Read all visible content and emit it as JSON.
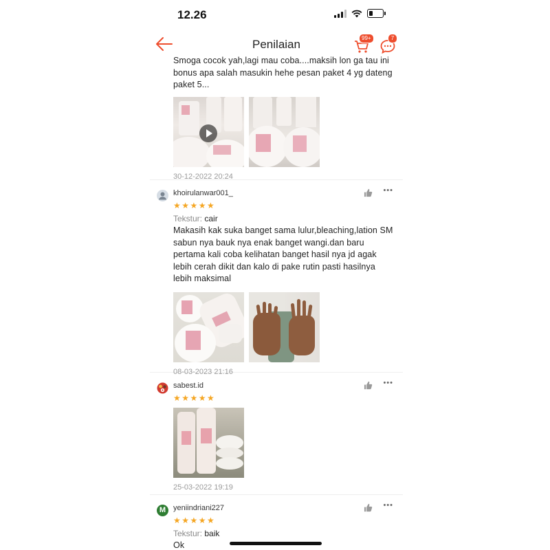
{
  "status_bar": {
    "time": "12.26"
  },
  "header": {
    "title": "Penilaian",
    "cart_badge": "99+",
    "chat_badge": "7"
  },
  "reviews": [
    {
      "text": "Smoga cocok yah,lagi mau coba....maksih lon ga tau ini bonus apa salah masukin hehe pesan paket 4 yg dateng paket 5...",
      "date": "30-12-2022 20:24",
      "photos": [
        "photo-bottles-jars-video",
        "photo-jars"
      ]
    },
    {
      "username": "khoirulanwar001_",
      "rating": 5,
      "stars": "★★★★★",
      "attr_key": "Tekstur:",
      "attr_value": "cair",
      "text": "Makasih kak suka banget sama lulur,bleaching,lation SM sabun nya bauk nya enak banget wangi.dan baru pertama kali coba kelihatan banget hasil nya jd agak lebih cerah dikit dan kalo di pake rutin pasti hasilnya lebih maksimal",
      "date": "08-03-2023 21:16"
    },
    {
      "username": "sabest.id",
      "rating": 5,
      "stars": "★★★★★",
      "date": "25-03-2022 19:19"
    },
    {
      "username": "yeniindriani227",
      "avatar_letter": "M",
      "rating": 5,
      "stars": "★★★★★",
      "attr_key": "Tekstur:",
      "attr_value": "baik",
      "text": "Ok"
    }
  ],
  "colors": {
    "accent": "#ee4d2d",
    "star": "#f5a623",
    "date": "#999999"
  }
}
